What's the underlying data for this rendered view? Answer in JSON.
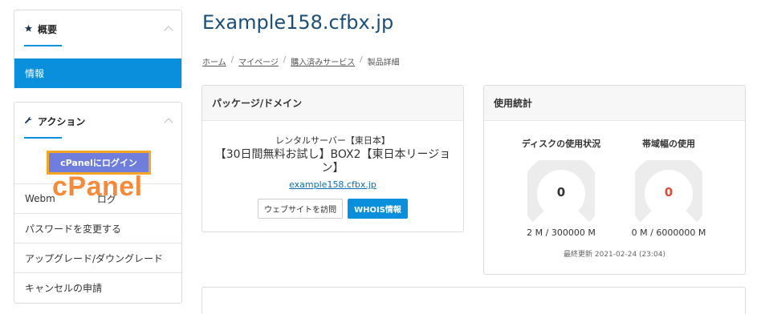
{
  "sidebar": {
    "overview": {
      "title": "概要",
      "active_item": "情報"
    },
    "actions": {
      "title": "アクション",
      "cpanel_button": "cPanelにログイン",
      "cpanel_overlay": "cPanel",
      "webmail_partial": "Webm",
      "webmail_trailing": "ログ",
      "items": [
        "パスワードを変更する",
        "アップグレード/ダウングレード",
        "キャンセルの申請"
      ]
    }
  },
  "main": {
    "title": "Example158.cfbx.jp",
    "breadcrumb": [
      "ホーム",
      "マイページ",
      "購入済みサービス",
      "製品詳細"
    ],
    "package": {
      "header": "パッケージ/ドメイン",
      "line1": "レンタルサーバー【東日本】",
      "line2": "【30日間無料お試し】BOX2【東日本リージョン】",
      "domain": "example158.cfbx.jp",
      "visit_button": "ウェブサイトを訪問",
      "whois_button": "WHOIS情報"
    },
    "stats": {
      "header": "使用統計",
      "disk": {
        "title": "ディスクの使用状況",
        "value": "0",
        "caption": "2 M / 300000 M",
        "color": "#333333",
        "fraction": 0
      },
      "bandwidth": {
        "title": "帯域幅の使用",
        "value": "0",
        "caption": "0 M / 6000000 M",
        "color": "#e04a3a",
        "fraction": 0
      },
      "updated": "最終更新 2021-02-24 (23:04)"
    }
  },
  "colors": {
    "accent": "#0a8fdc",
    "title": "#1b4f7a",
    "highlight_border": "#f5a623",
    "overlay_text": "#f58a3a"
  }
}
